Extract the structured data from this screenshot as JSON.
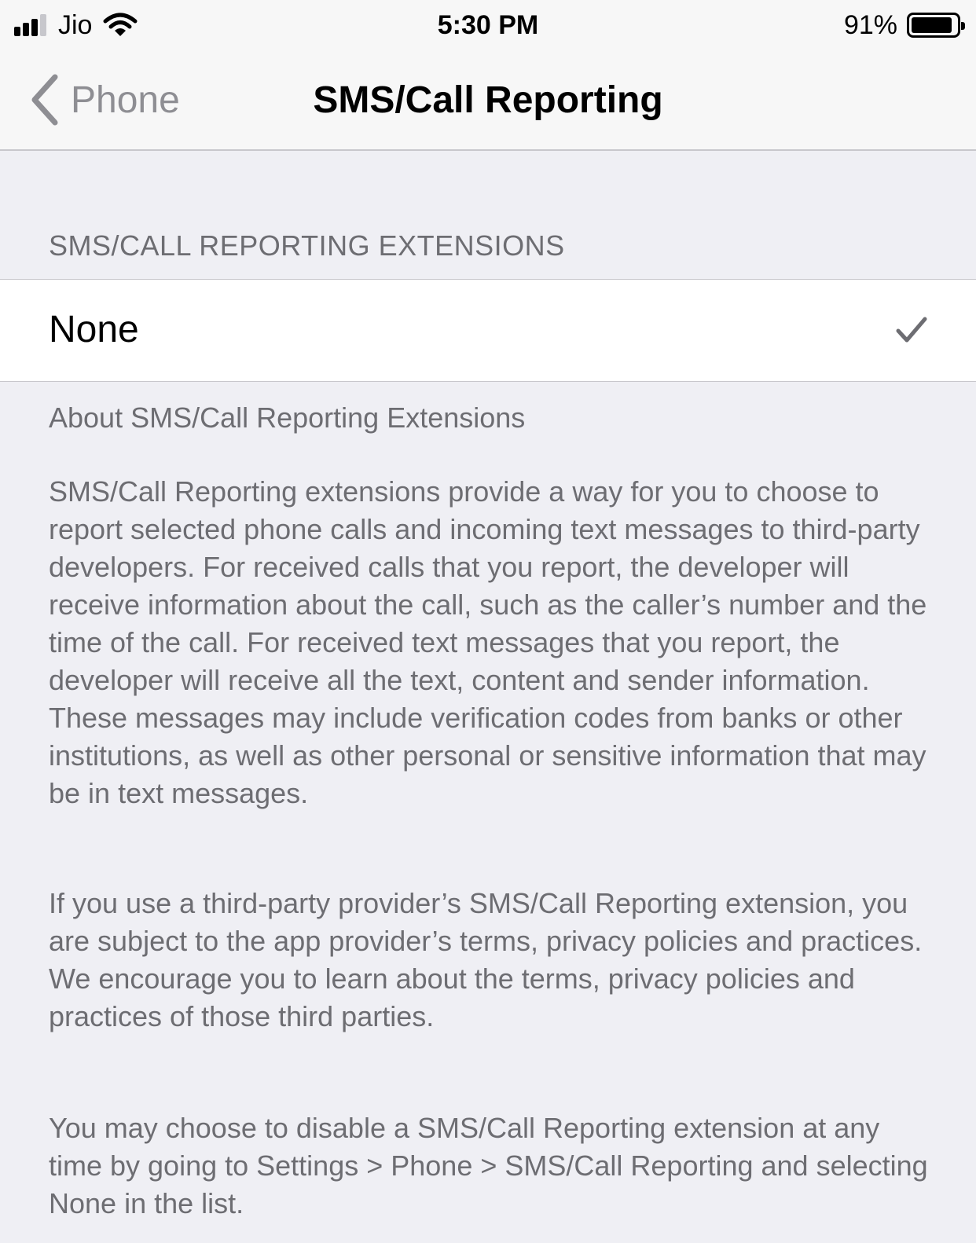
{
  "status_bar": {
    "carrier": "Jio",
    "time": "5:30 PM",
    "battery_percent": "91%",
    "battery_level": 0.91,
    "signal_bars_filled": 3,
    "signal_bars_total": 4,
    "icons": [
      "signal-icon",
      "wifi-icon",
      "battery-icon"
    ]
  },
  "nav": {
    "back_label": "Phone",
    "title": "SMS/Call Reporting",
    "back_icon": "chevron-left-icon"
  },
  "section": {
    "header": "SMS/CALL REPORTING EXTENSIONS",
    "options": [
      {
        "label": "None",
        "selected": true,
        "icon": "checkmark-icon"
      }
    ]
  },
  "footer": {
    "heading": "About SMS/Call Reporting Extensions",
    "paragraphs": [
      "SMS/Call Reporting extensions provide a way for you to choose to report selected phone calls and incoming text messages to third-party developers. For received calls that you report, the developer will receive information about the call, such as the caller’s number and the time of the call. For received text messages that you report, the developer will receive all the text, content and sender information. These messages may include verification codes from banks or other institutions, as well as other personal or sensitive information that may be in text messages.",
      "If you use a third-party provider’s SMS/Call Reporting extension, you are subject to the app provider’s terms, privacy policies and practices. We encourage you to learn about the terms, privacy policies and practices of those third parties.",
      "You may choose to disable a SMS/Call Reporting extension at any time by going to Settings > Phone > SMS/Call Reporting and selecting None in the list."
    ]
  },
  "colors": {
    "background": "#efeff4",
    "bar_background": "#f7f7f7",
    "secondary_text": "#6d6d72",
    "back_text": "#8e8e93",
    "checkmark": "#6d6d72",
    "separator": "#c8c7cc"
  }
}
